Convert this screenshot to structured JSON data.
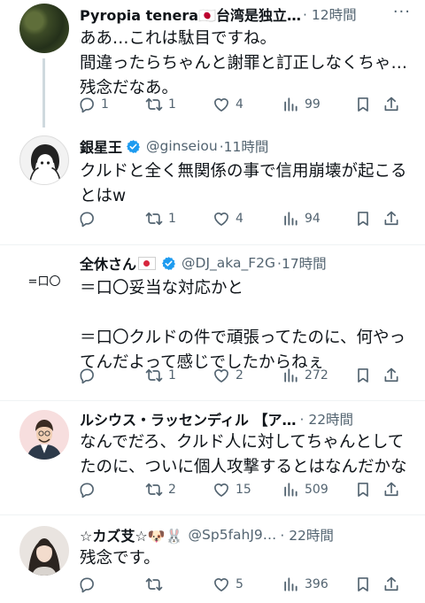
{
  "tweets": [
    {
      "name": "Pyropia tenera🇯🇵台湾是独立…",
      "handle": "",
      "time": "12時間",
      "text": "ああ…これは駄目ですね。\n間違ったらちゃんと謝罪と訂正しなくちゃ…残念だなあ。",
      "replies": "1",
      "retweets": "1",
      "likes": "4",
      "views": "99"
    },
    {
      "name": "銀星王",
      "handle": "@ginseiou",
      "time": "11時間",
      "text": "クルドと全く無関係の事で信用崩壊が起こるとはw",
      "replies": "",
      "retweets": "1",
      "likes": "4",
      "views": "94"
    },
    {
      "name": "全休さん",
      "handle": "@DJ_aka_F2G",
      "time": "17時間",
      "avatar_text": "=口〇",
      "text": "＝口〇妥当な対応かと\n\n＝口〇クルドの件で頑張ってたのに、何やってんだよって感じでしたからねぇ",
      "replies": "",
      "retweets": "1",
      "likes": "2",
      "views": "272"
    },
    {
      "name": "ルシウス・ラッセンディル 【ア…",
      "handle": "",
      "time": "22時間",
      "text": "なんでだろ、クルド人に対してちゃんとしてたのに、ついに個人攻撃するとはなんだかな",
      "replies": "",
      "retweets": "2",
      "likes": "15",
      "views": "509"
    },
    {
      "name": "☆カズ𦫿☆🐶🐰",
      "handle": "@Sp5fahJ9…",
      "time": "22時間",
      "text": "残念です。",
      "replies": "",
      "retweets": "",
      "likes": "5",
      "views": "396"
    }
  ],
  "dot": "·",
  "colors": {
    "text": "#0f1419",
    "muted": "#536471",
    "verified": "#1d9bf0",
    "divider": "#eff3f4"
  },
  "icons": [
    "reply-icon",
    "retweet-icon",
    "like-icon",
    "views-icon",
    "bookmark-icon",
    "share-icon",
    "verified-icon",
    "more-icon"
  ]
}
